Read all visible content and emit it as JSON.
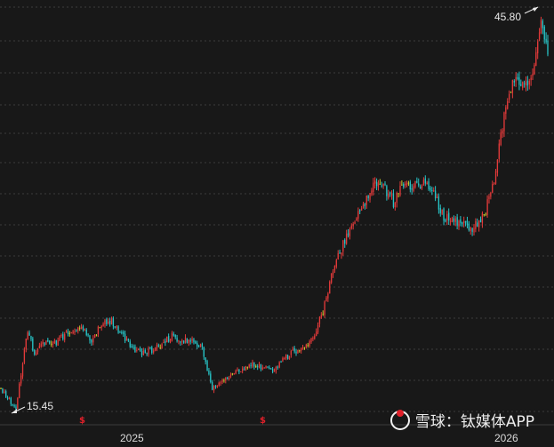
{
  "chart_data": {
    "type": "candlestick",
    "title": "",
    "xlabel": "",
    "ylabel": "",
    "x_tick_labels": [
      "2025",
      "2026"
    ],
    "ylim": [
      14.5,
      47.5
    ],
    "grid": true,
    "annotations": {
      "low": "15.45",
      "high": "45.80"
    },
    "dividend_marker_symbol": "$",
    "colors": {
      "up": "#e33a3a",
      "down": "#27c4c7",
      "flat": "#c8cc2e",
      "background": "#181818",
      "grid": "#3c3c3c"
    },
    "price_points": [
      {
        "i": 0,
        "p": 17.3
      },
      {
        "i": 6,
        "p": 16.2
      },
      {
        "i": 9,
        "p": 15.6
      },
      {
        "i": 12,
        "p": 18.5
      },
      {
        "i": 16,
        "p": 21.8
      },
      {
        "i": 20,
        "p": 20.0
      },
      {
        "i": 24,
        "p": 21.0
      },
      {
        "i": 30,
        "p": 20.6
      },
      {
        "i": 36,
        "p": 21.3
      },
      {
        "i": 42,
        "p": 21.9
      },
      {
        "i": 48,
        "p": 22.2
      },
      {
        "i": 54,
        "p": 21.0
      },
      {
        "i": 60,
        "p": 22.4
      },
      {
        "i": 66,
        "p": 22.5
      },
      {
        "i": 72,
        "p": 21.6
      },
      {
        "i": 78,
        "p": 20.4
      },
      {
        "i": 84,
        "p": 20.1
      },
      {
        "i": 90,
        "p": 20.3
      },
      {
        "i": 96,
        "p": 20.8
      },
      {
        "i": 102,
        "p": 21.4
      },
      {
        "i": 108,
        "p": 21.0
      },
      {
        "i": 114,
        "p": 21.1
      },
      {
        "i": 120,
        "p": 20.4
      },
      {
        "i": 126,
        "p": 17.2
      },
      {
        "i": 132,
        "p": 17.8
      },
      {
        "i": 138,
        "p": 18.6
      },
      {
        "i": 144,
        "p": 18.9
      },
      {
        "i": 150,
        "p": 19.2
      },
      {
        "i": 156,
        "p": 19.0
      },
      {
        "i": 162,
        "p": 18.6
      },
      {
        "i": 168,
        "p": 19.5
      },
      {
        "i": 174,
        "p": 20.2
      },
      {
        "i": 180,
        "p": 20.4
      },
      {
        "i": 186,
        "p": 21.2
      },
      {
        "i": 192,
        "p": 23.4
      },
      {
        "i": 198,
        "p": 26.5
      },
      {
        "i": 204,
        "p": 28.5
      },
      {
        "i": 210,
        "p": 30.0
      },
      {
        "i": 216,
        "p": 31.5
      },
      {
        "i": 222,
        "p": 33.4
      },
      {
        "i": 228,
        "p": 33.0
      },
      {
        "i": 234,
        "p": 31.8
      },
      {
        "i": 240,
        "p": 33.2
      },
      {
        "i": 246,
        "p": 33.0
      },
      {
        "i": 252,
        "p": 33.3
      },
      {
        "i": 258,
        "p": 32.6
      },
      {
        "i": 264,
        "p": 30.6
      },
      {
        "i": 270,
        "p": 30.4
      },
      {
        "i": 276,
        "p": 30.0
      },
      {
        "i": 282,
        "p": 29.8
      },
      {
        "i": 288,
        "p": 30.8
      },
      {
        "i": 294,
        "p": 33.5
      },
      {
        "i": 300,
        "p": 38.5
      },
      {
        "i": 306,
        "p": 41.5
      },
      {
        "i": 312,
        "p": 40.5
      },
      {
        "i": 318,
        "p": 42.5
      },
      {
        "i": 322,
        "p": 45.8
      },
      {
        "i": 326,
        "p": 43.2
      }
    ]
  }
}
